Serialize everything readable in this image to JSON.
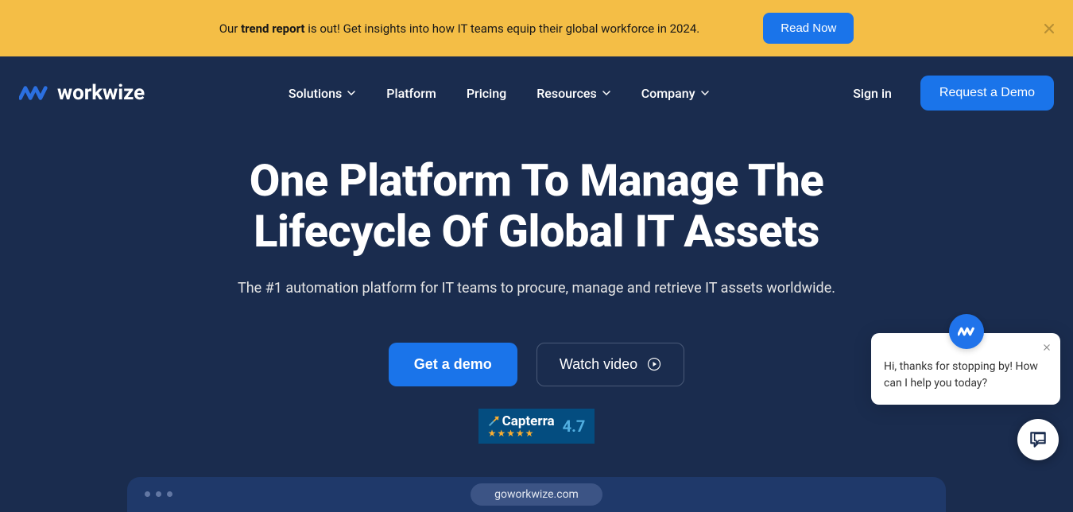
{
  "banner": {
    "text_prefix": "Our ",
    "text_bold": "trend report",
    "text_suffix": " is out! Get insights into how IT teams equip their global workforce in 2024.",
    "button": "Read Now"
  },
  "header": {
    "brand": "workwize",
    "nav": {
      "solutions": "Solutions",
      "platform": "Platform",
      "pricing": "Pricing",
      "resources": "Resources",
      "company": "Company"
    },
    "signin": "Sign in",
    "demo_button": "Request a Demo"
  },
  "hero": {
    "title_line1": "One Platform To Manage The",
    "title_line2": "Lifecycle Of Global IT Assets",
    "subtitle": "The #1 automation platform for IT teams to procure, manage and retrieve IT assets worldwide.",
    "get_demo": "Get a demo",
    "watch_video": "Watch video"
  },
  "capterra": {
    "name": "Capterra",
    "stars": "★★★★★",
    "rating": "4.7"
  },
  "browser": {
    "url": "goworkwize.com"
  },
  "chat": {
    "message": "Hi, thanks for stopping by! How can I help you today?"
  }
}
